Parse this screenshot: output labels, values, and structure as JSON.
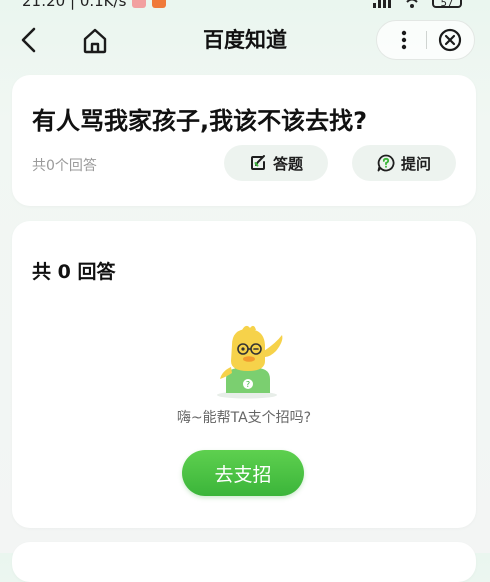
{
  "status_bar": {
    "left_text": "21:20 | 0.1K/s",
    "battery": "57"
  },
  "nav": {
    "title": "百度知道"
  },
  "question": {
    "title": "有人骂我家孩子,我该不该去找?",
    "answer_count_text": "共0个回答",
    "answer_button_label": "答题",
    "ask_button_label": "提问"
  },
  "answers": {
    "heading": "共 0 回答",
    "empty_prompt": "嗨~能帮TA支个招吗?",
    "help_button_label": "去支招"
  },
  "colors": {
    "accent_green": "#3bb53a",
    "pill_bg": "#edf3ef",
    "page_bg": "#eaf6ef"
  }
}
